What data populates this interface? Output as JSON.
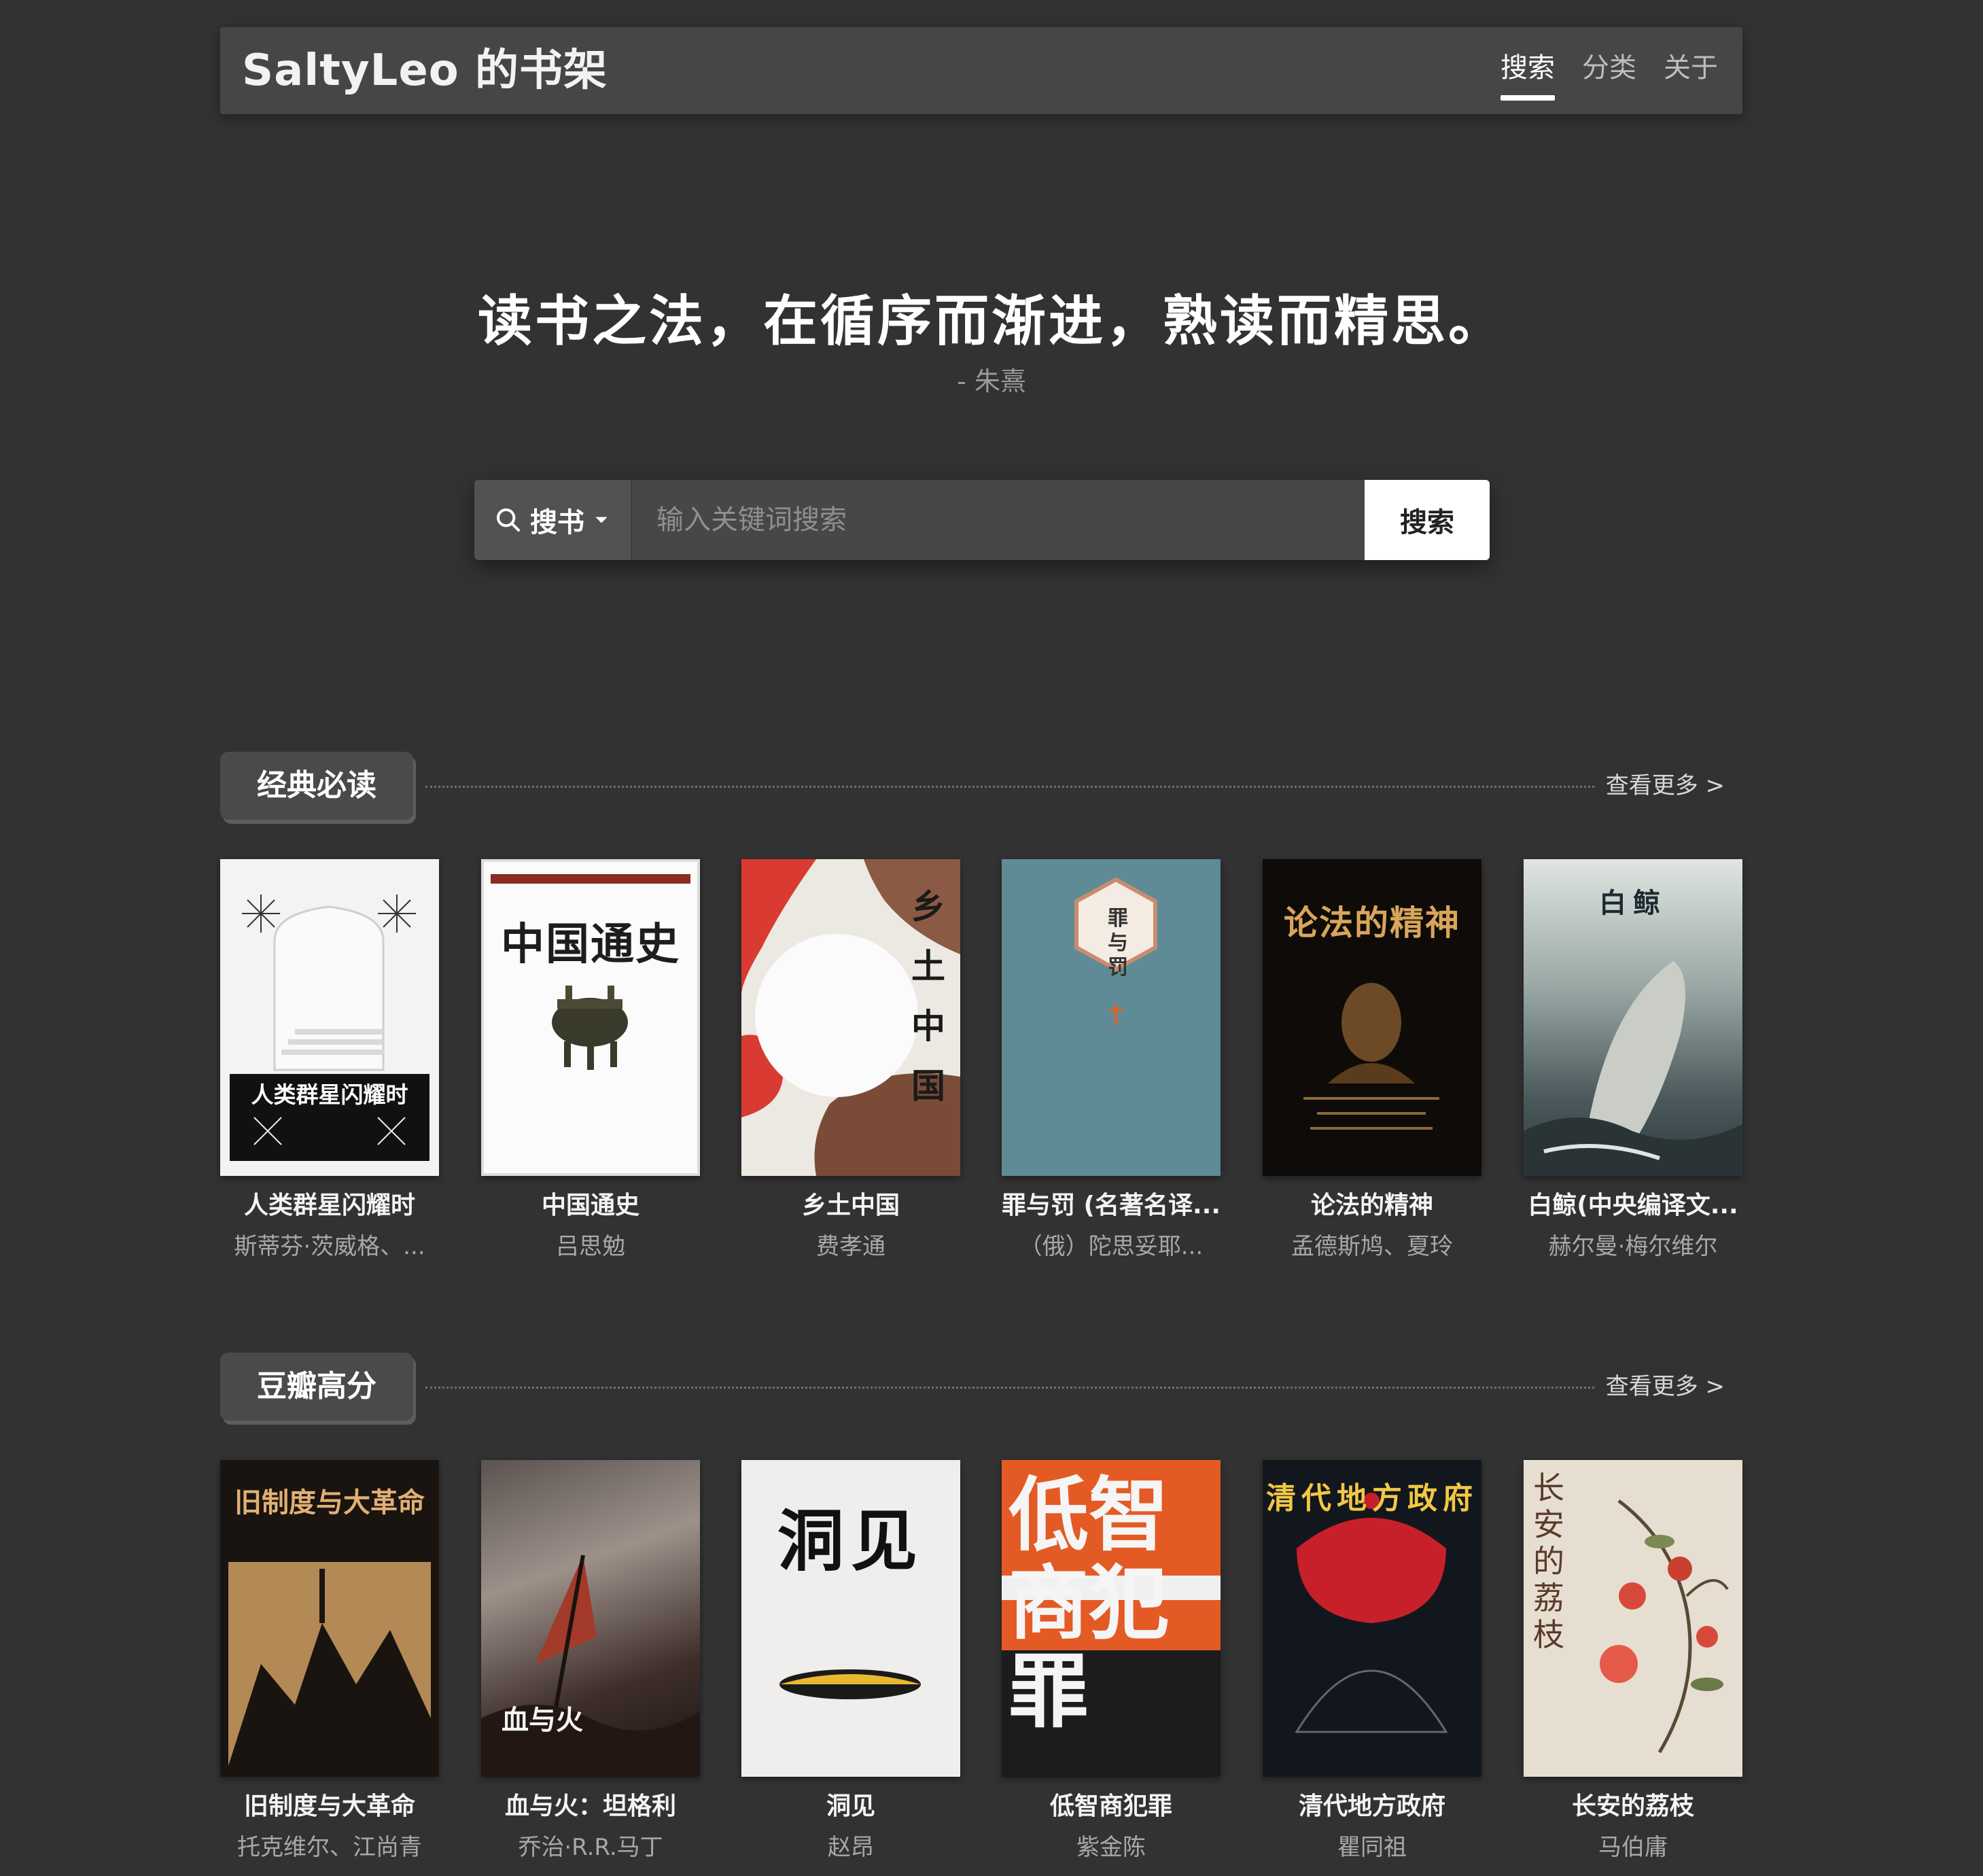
{
  "header": {
    "brand": "SaltyLeo 的书架",
    "nav": [
      "搜索",
      "分类",
      "关于"
    ]
  },
  "hero": {
    "quote": "读书之法，在循序而渐进，熟读而精思。",
    "author": "- 朱熹"
  },
  "search": {
    "type_label": "搜书",
    "placeholder": "输入关键词搜索",
    "button": "搜索"
  },
  "sections": [
    {
      "title": "经典必读",
      "more": "查看更多 >",
      "books": [
        {
          "title": "人类群星闪耀时",
          "author": "斯蒂芬·茨威格、...",
          "cover_text": "人类群星闪耀时"
        },
        {
          "title": "中国通史",
          "author": "吕思勉",
          "cover_text": "中国通史"
        },
        {
          "title": "乡土中国",
          "author": "费孝通",
          "cover_text": "乡土中国"
        },
        {
          "title": "罪与罚 (名著名译...",
          "author": "（俄）陀思妥耶...",
          "cover_text": "罪与罚"
        },
        {
          "title": "论法的精神",
          "author": "孟德斯鸠、夏玲",
          "cover_text": "论法的精神"
        },
        {
          "title": "白鲸(中央编译文...",
          "author": "赫尔曼·梅尔维尔",
          "cover_text": "白鲸"
        }
      ]
    },
    {
      "title": "豆瓣高分",
      "more": "查看更多 >",
      "books": [
        {
          "title": "旧制度与大革命",
          "author": "托克维尔、江尚青",
          "cover_text": "旧制度与大革命"
        },
        {
          "title": "血与火：坦格利",
          "author": "乔治·R.R.马丁",
          "cover_text": "血与火"
        },
        {
          "title": "洞见",
          "author": "赵昂",
          "cover_text": "洞见"
        },
        {
          "title": "低智商犯罪",
          "author": "紫金陈",
          "cover_text": "低智商犯罪"
        },
        {
          "title": "清代地方政府",
          "author": "瞿同祖",
          "cover_text": "清代地方政府"
        },
        {
          "title": "长安的荔枝",
          "author": "马伯庸",
          "cover_text": "长安的荔枝"
        }
      ]
    }
  ],
  "colors": {
    "background": "#323232",
    "navbar": "#464646",
    "search_button": "#ffffff"
  }
}
